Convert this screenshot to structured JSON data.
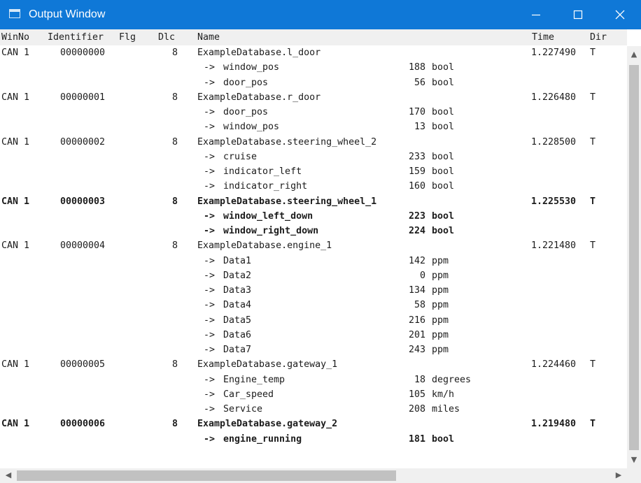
{
  "window": {
    "title": "Output Window",
    "icon": "window-app-icon",
    "controls": [
      "minimize-icon",
      "maximize-icon",
      "close-icon"
    ],
    "accent_color": "#0f78d7"
  },
  "columns": {
    "winno": "WinNo",
    "identifier": "Identifier",
    "flg": "Flg",
    "dlc": "Dlc",
    "name": "Name",
    "time": "Time",
    "dir": "Dir"
  },
  "messages": [
    {
      "winno": "CAN 1",
      "identifier": "00000000",
      "dlc": "8",
      "name": "ExampleDatabase.l_door",
      "time": "1.227490",
      "dir": "T",
      "bold": false,
      "signals": [
        {
          "arrow": "->",
          "name": "window_pos",
          "value": "188",
          "unit": "bool"
        },
        {
          "arrow": "->",
          "name": "door_pos",
          "value": "56",
          "unit": "bool"
        }
      ]
    },
    {
      "winno": "CAN 1",
      "identifier": "00000001",
      "dlc": "8",
      "name": "ExampleDatabase.r_door",
      "time": "1.226480",
      "dir": "T",
      "bold": false,
      "signals": [
        {
          "arrow": "->",
          "name": "door_pos",
          "value": "170",
          "unit": "bool"
        },
        {
          "arrow": "->",
          "name": "window_pos",
          "value": "13",
          "unit": "bool"
        }
      ]
    },
    {
      "winno": "CAN 1",
      "identifier": "00000002",
      "dlc": "8",
      "name": "ExampleDatabase.steering_wheel_2",
      "time": "1.228500",
      "dir": "T",
      "bold": false,
      "signals": [
        {
          "arrow": "->",
          "name": "cruise",
          "value": "233",
          "unit": "bool"
        },
        {
          "arrow": "->",
          "name": "indicator_left",
          "value": "159",
          "unit": "bool"
        },
        {
          "arrow": "->",
          "name": "indicator_right",
          "value": "160",
          "unit": "bool"
        }
      ]
    },
    {
      "winno": "CAN 1",
      "identifier": "00000003",
      "dlc": "8",
      "name": "ExampleDatabase.steering_wheel_1",
      "time": "1.225530",
      "dir": "T",
      "bold": true,
      "signals": [
        {
          "arrow": "->",
          "name": "window_left_down",
          "value": "223",
          "unit": "bool"
        },
        {
          "arrow": "->",
          "name": "window_right_down",
          "value": "224",
          "unit": "bool"
        }
      ]
    },
    {
      "winno": "CAN 1",
      "identifier": "00000004",
      "dlc": "8",
      "name": "ExampleDatabase.engine_1",
      "time": "1.221480",
      "dir": "T",
      "bold": false,
      "signals": [
        {
          "arrow": "->",
          "name": "Data1",
          "value": "142",
          "unit": "ppm"
        },
        {
          "arrow": "->",
          "name": "Data2",
          "value": "0",
          "unit": "ppm"
        },
        {
          "arrow": "->",
          "name": "Data3",
          "value": "134",
          "unit": "ppm"
        },
        {
          "arrow": "->",
          "name": "Data4",
          "value": "58",
          "unit": "ppm"
        },
        {
          "arrow": "->",
          "name": "Data5",
          "value": "216",
          "unit": "ppm"
        },
        {
          "arrow": "->",
          "name": "Data6",
          "value": "201",
          "unit": "ppm"
        },
        {
          "arrow": "->",
          "name": "Data7",
          "value": "243",
          "unit": "ppm"
        }
      ]
    },
    {
      "winno": "CAN 1",
      "identifier": "00000005",
      "dlc": "8",
      "name": "ExampleDatabase.gateway_1",
      "time": "1.224460",
      "dir": "T",
      "bold": false,
      "signals": [
        {
          "arrow": "->",
          "name": "Engine_temp",
          "value": "18",
          "unit": "degrees"
        },
        {
          "arrow": "->",
          "name": "Car_speed",
          "value": "105",
          "unit": "km/h"
        },
        {
          "arrow": "->",
          "name": "Service",
          "value": "208",
          "unit": "miles"
        }
      ]
    },
    {
      "winno": "CAN 1",
      "identifier": "00000006",
      "dlc": "8",
      "name": "ExampleDatabase.gateway_2",
      "time": "1.219480",
      "dir": "T",
      "bold": true,
      "signals": [
        {
          "arrow": "->",
          "name": "engine_running",
          "value": "181",
          "unit": "bool"
        }
      ]
    }
  ],
  "scrollbars": {
    "up_arrow": "▲",
    "down_arrow": "▼",
    "left_arrow": "◀",
    "right_arrow": "▶"
  }
}
